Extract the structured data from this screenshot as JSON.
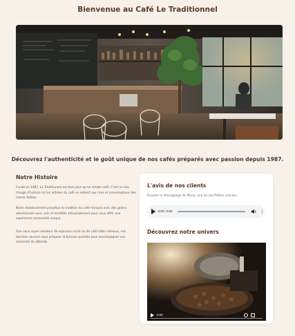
{
  "page": {
    "title": "Bienvenue au Café Le Traditionnel"
  },
  "hero": {
    "image": "cafe-interior-photo"
  },
  "tagline": "Découvrez l'authenticité et le goût unique de nos cafés préparés avec passion depuis 1987.",
  "story": {
    "title": "Notre Histoire",
    "paragraphs": [
      "Fondé en 1987, Le Traditionnel est bien plus qu'un simple café. C'est un lieu chargé d'histoire où les arômes du café se mêlent aux rires et conversations des clients fidèles.",
      "Notre établissement perpétue la tradition du café français avec des grains sélectionnés avec soin et torréfiés artisanalement pour vous offrir une expérience sensorielle unique.",
      "Que vous soyez amateur de espresso corsé ou de café latte crémeux, nos baristas sauront vous préparer la boisson parfaite pour accompagner vos moments de détente."
    ]
  },
  "testimonial": {
    "title": "L'avis de nos clients",
    "subtitle": "Écoutez le témoignage de Marie, une de nos fidèles clientes :",
    "audio": {
      "time": "0:00 / 0:00",
      "play_icon": "play-icon",
      "volume_icon": "volume-icon",
      "menu_icon": "more-vert-icon"
    }
  },
  "universe": {
    "title": "Découvrez notre univers",
    "video": {
      "time": "0:00",
      "play_icon": "play-icon",
      "fullscreen_icon": "fullscreen-icon",
      "volume_icon": "volume-icon",
      "menu_icon": "more-vert-icon"
    }
  },
  "colors": {
    "background": "#f8f1e9",
    "heading": "#4e3427",
    "card": "#ffffff"
  }
}
